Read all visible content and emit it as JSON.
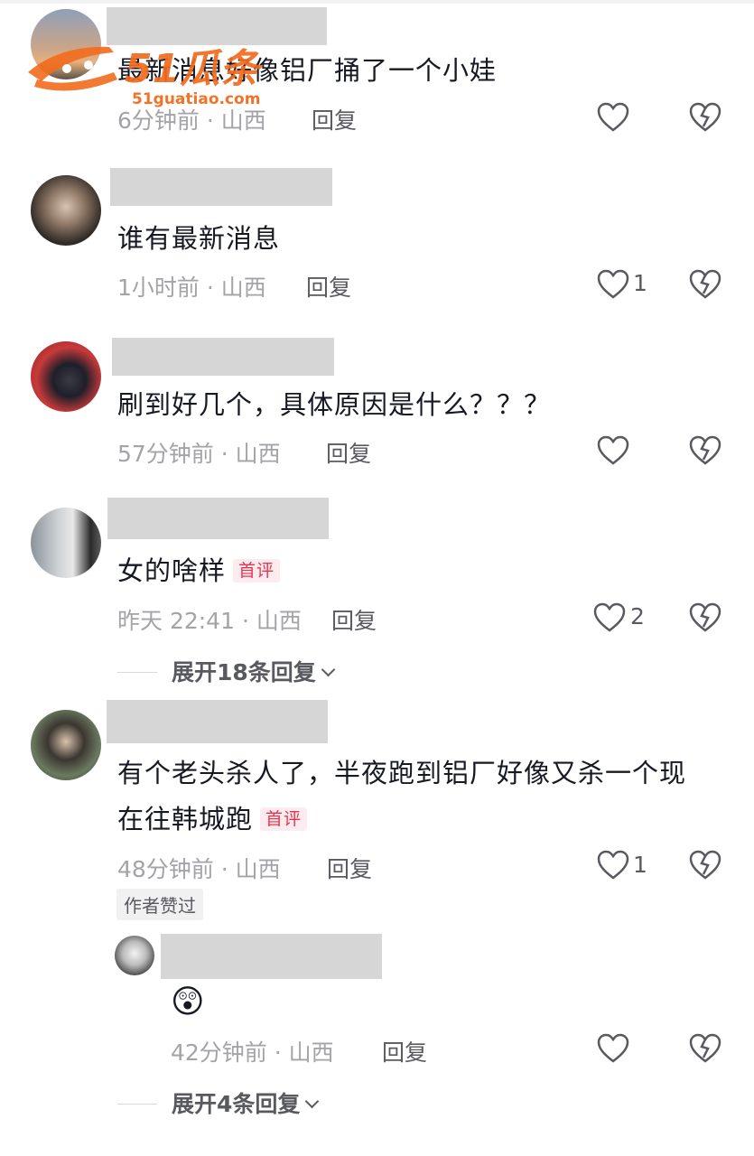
{
  "watermark": {
    "brand": "51瓜条",
    "url": "51guatiao.com"
  },
  "comments": [
    {
      "text": "最新消息好像铝厂捅了一个小娃",
      "meta": "6分钟前 · 山西",
      "reply": "回复",
      "likes": "",
      "tag": ""
    },
    {
      "text": "谁有最新消息",
      "meta": "1小时前 · 山西",
      "reply": "回复",
      "likes": "1",
      "tag": ""
    },
    {
      "text": "刷到好几个，具体原因是什么？？？",
      "meta": "57分钟前 · 山西",
      "reply": "回复",
      "likes": "",
      "tag": ""
    },
    {
      "text": "女的啥样",
      "meta": "昨天 22:41 · 山西",
      "reply": "回复",
      "likes": "2",
      "tag": "首评",
      "expand": "展开18条回复"
    },
    {
      "text_line1": "有个老头杀人了，半夜跑到铝厂好像又杀一个现",
      "text_line2": "在往韩城跑",
      "meta": "48分钟前 · 山西",
      "reply": "回复",
      "likes": "1",
      "tag": "首评",
      "author_badge": "作者赞过",
      "sub_reply": {
        "emoji": "😲",
        "meta": "42分钟前 · 山西",
        "reply": "回复",
        "likes": ""
      },
      "expand": "展开4条回复"
    }
  ],
  "colors": {
    "like_icon": "#595960",
    "tag": "#e8334f",
    "meta": "#a3a3a8"
  }
}
